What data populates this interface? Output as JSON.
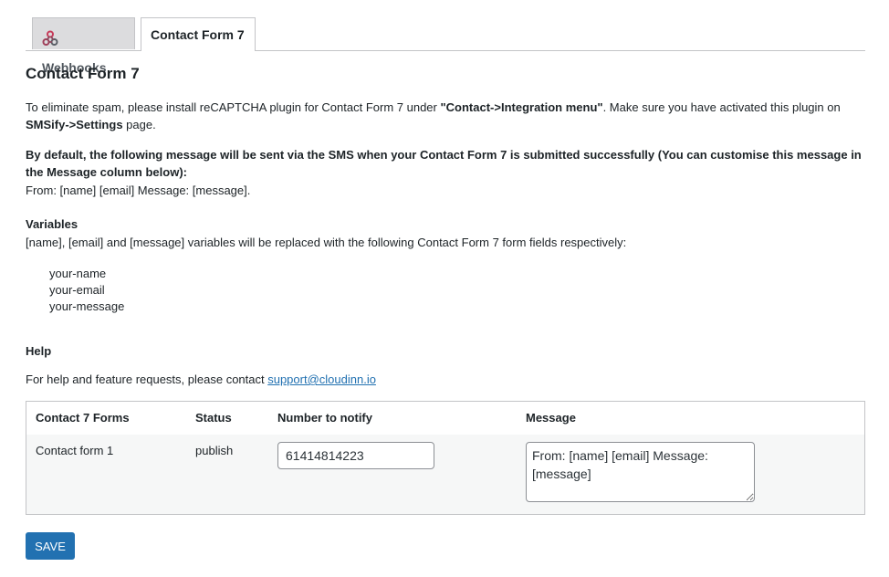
{
  "tabs": [
    {
      "label": "Webhooks",
      "icon": "webhook-icon"
    },
    {
      "label": "Contact Form 7"
    }
  ],
  "title": "Contact Form 7",
  "intro": {
    "part1": "To eliminate spam, please install reCAPTCHA plugin for Contact Form 7 under ",
    "bold1": "\"Contact->Integration menu\"",
    "part2": ". Make sure you have activated this plugin on ",
    "bold2": "SMSify->Settings",
    "part3": " page."
  },
  "default_msg_note": "By default, the following message will be sent via the SMS when your Contact Form 7 is submitted successfully (You can customise this message in the Message column below):",
  "default_msg": "From: [name] [email] Message: [message].",
  "variables": {
    "heading": "Variables",
    "text": "[name], [email] and [message] variables will be replaced with the following Contact Form 7 form fields respectively:",
    "fields": [
      "your-name",
      "your-email",
      "your-message"
    ]
  },
  "help": {
    "heading": "Help",
    "text": "For help and feature requests, please contact ",
    "link": "support@cloudinn.io"
  },
  "table": {
    "headers": [
      "Contact 7 Forms",
      "Status",
      "Number to notify",
      "Message"
    ],
    "rows": [
      {
        "form": "Contact form 1",
        "status": "publish",
        "number": "61414814223",
        "message": "From: [name] [email] Message: [message]"
      }
    ]
  },
  "save_label": "SAVE",
  "colors": {
    "accent": "#2271b1",
    "tab_inactive": "#dcdcde"
  }
}
